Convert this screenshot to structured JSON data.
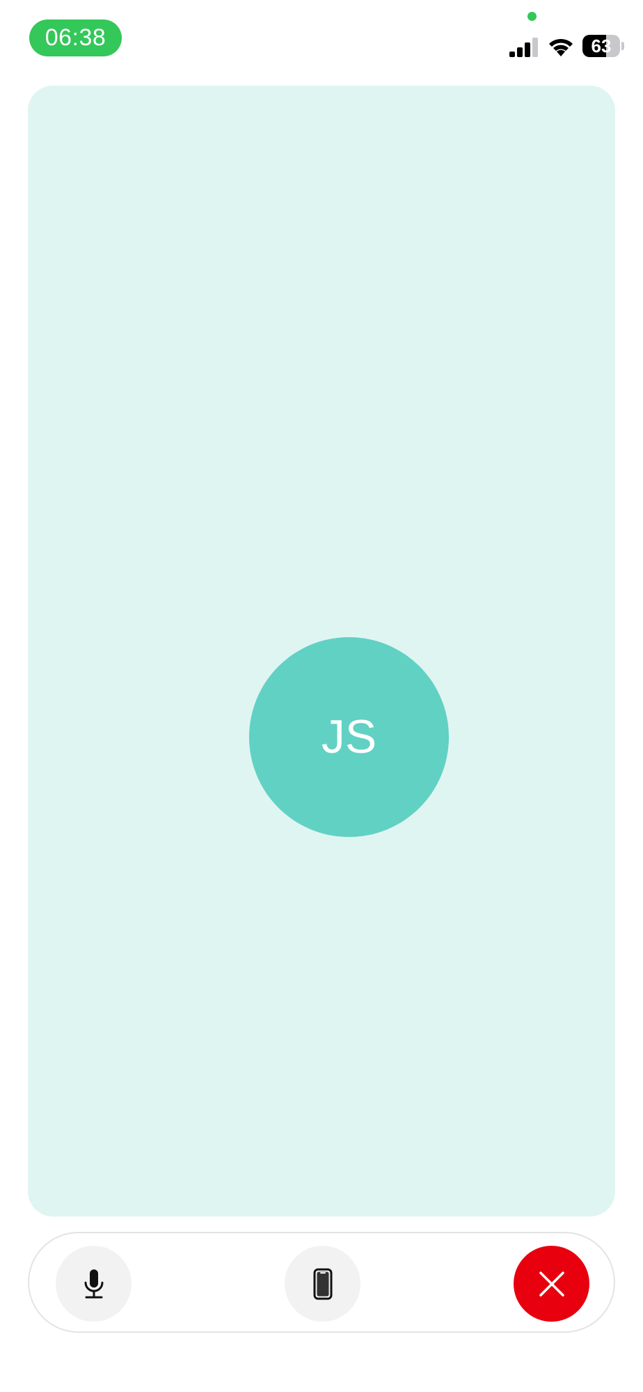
{
  "status_bar": {
    "time": "06:38",
    "battery_percent": "63",
    "battery_level": 0.63,
    "signal_icon": "cellular-signal-icon",
    "wifi_icon": "wifi-icon",
    "recording_indicator_color": "#34c759"
  },
  "call": {
    "participant_initials": "JS",
    "tile_background": "#dff5f1",
    "avatar_color": "#61d1c4"
  },
  "controls": {
    "mute_icon": "microphone-icon",
    "device_icon": "phone-device-icon",
    "end_call_icon": "close-icon",
    "end_call_color": "#e8000f"
  }
}
